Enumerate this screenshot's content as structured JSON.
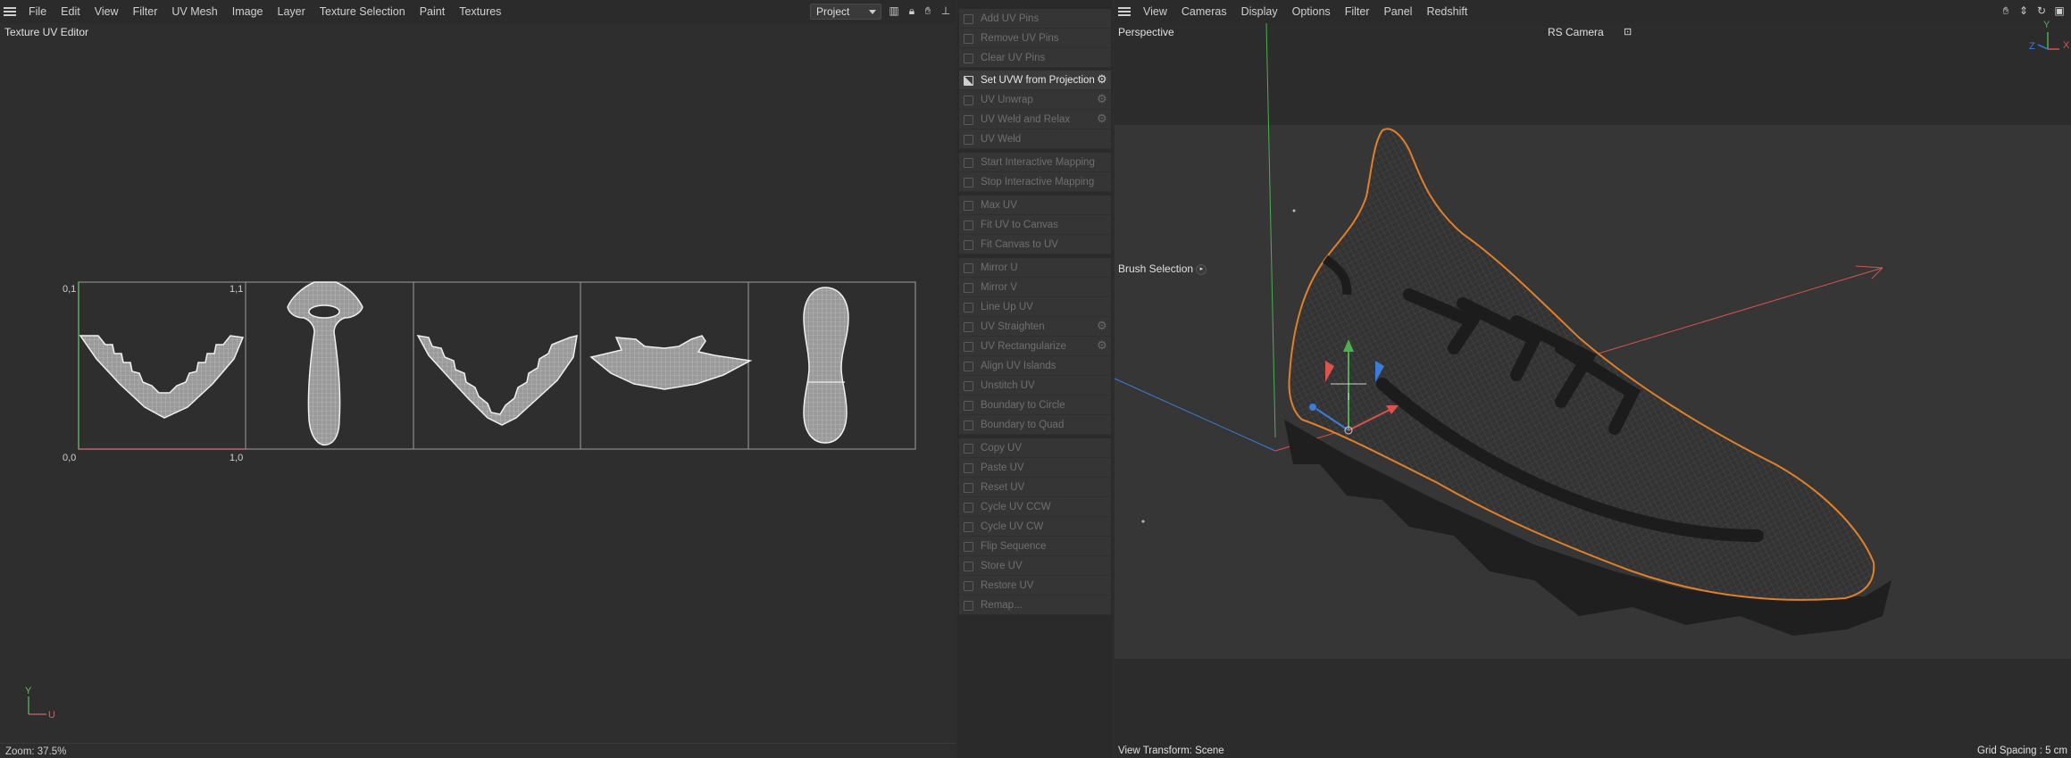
{
  "uv_editor": {
    "menu": [
      "File",
      "Edit",
      "View",
      "Filter",
      "UV Mesh",
      "Image",
      "Layer",
      "Texture Selection",
      "Paint",
      "Textures"
    ],
    "project_select": "Project",
    "title": "Texture UV Editor",
    "corner_labels": {
      "top_left": "0,1",
      "top_right": "1,1",
      "bottom_left": "0,0",
      "bottom_right": "1,0"
    },
    "axis_labels": {
      "v": "Y",
      "u": "U"
    },
    "zoom": "Zoom: 37.5%"
  },
  "commands": {
    "group1": [
      {
        "label": "Add UV Pins",
        "active": false
      },
      {
        "label": "Remove UV Pins",
        "active": false
      },
      {
        "label": "Clear UV Pins",
        "active": false
      }
    ],
    "group2": [
      {
        "label": "Set UVW from Projection",
        "active": true,
        "gear": true
      },
      {
        "label": "UV Unwrap",
        "active": false,
        "gear": true
      },
      {
        "label": "UV Weld and Relax",
        "active": false,
        "gear": true
      },
      {
        "label": "UV Weld",
        "active": false
      }
    ],
    "group3": [
      {
        "label": "Start Interactive Mapping",
        "active": false
      },
      {
        "label": "Stop Interactive Mapping",
        "active": false
      }
    ],
    "group4": [
      {
        "label": "Max UV",
        "active": false
      },
      {
        "label": "Fit UV to Canvas",
        "active": false
      },
      {
        "label": "Fit Canvas to UV",
        "active": false
      }
    ],
    "group5": [
      {
        "label": "Mirror U",
        "active": false
      },
      {
        "label": "Mirror V",
        "active": false
      },
      {
        "label": "Line Up UV",
        "active": false
      },
      {
        "label": "UV Straighten",
        "active": false,
        "gear": true
      },
      {
        "label": "UV Rectangularize",
        "active": false,
        "gear": true
      },
      {
        "label": "Align UV Islands",
        "active": false
      },
      {
        "label": "Unstitch UV",
        "active": false
      },
      {
        "label": "Boundary to Circle",
        "active": false
      },
      {
        "label": "Boundary to Quad",
        "active": false
      }
    ],
    "group6": [
      {
        "label": "Copy UV",
        "active": false
      },
      {
        "label": "Paste UV",
        "active": false
      },
      {
        "label": "Reset UV",
        "active": false
      },
      {
        "label": "Cycle UV CCW",
        "active": false
      },
      {
        "label": "Cycle UV CW",
        "active": false
      },
      {
        "label": "Flip Sequence",
        "active": false
      },
      {
        "label": "Store UV",
        "active": false
      },
      {
        "label": "Restore UV",
        "active": false
      },
      {
        "label": "Remap...",
        "active": false
      }
    ]
  },
  "viewport": {
    "menu": [
      "View",
      "Cameras",
      "Display",
      "Options",
      "Filter",
      "Panel",
      "Redshift"
    ],
    "view_name": "Perspective",
    "camera": "RS Camera",
    "brush_selection": "Brush Selection",
    "view_transform": "View Transform: Scene",
    "grid_spacing": "Grid Spacing : 5 cm",
    "axis_labels": {
      "x": "X",
      "y": "Y",
      "z": "Z"
    }
  },
  "colors": {
    "accent_orange": "#e0802a",
    "axis_red": "#d9534f",
    "axis_green": "#4caf50",
    "axis_blue": "#3b7dd8"
  }
}
